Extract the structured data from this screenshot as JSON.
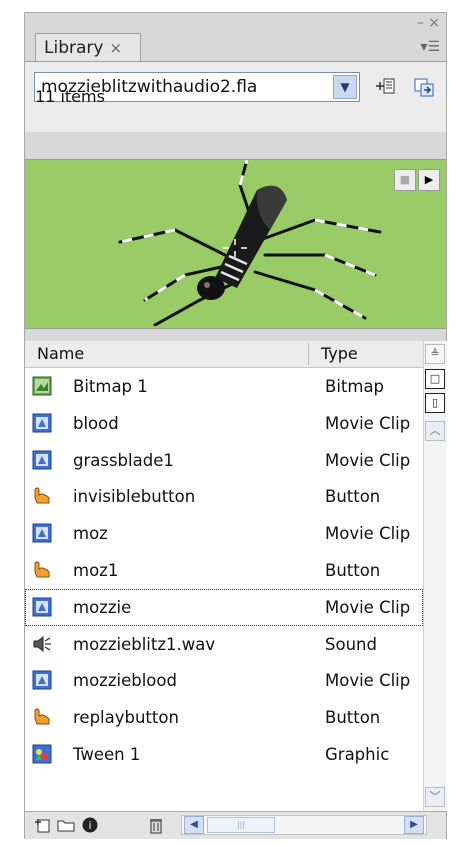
{
  "panel": {
    "tab_label": "Library",
    "tab_close": "×",
    "window_controls": "– ×",
    "panel_menu": "▾☰"
  },
  "topbar": {
    "document_select": "mozzieblitzwithaudio2.fla",
    "item_count": "11 items"
  },
  "preview": {
    "background_color": "#99cc66"
  },
  "columns": {
    "name": "Name",
    "type": "Type"
  },
  "items": [
    {
      "name": "Bitmap 1",
      "type": "Bitmap",
      "icon": "bitmap-icon"
    },
    {
      "name": "blood",
      "type": "Movie Clip",
      "icon": "movie-clip-icon"
    },
    {
      "name": "grassblade1",
      "type": "Movie Clip",
      "icon": "movie-clip-icon"
    },
    {
      "name": "invisiblebutton",
      "type": "Button",
      "icon": "button-symbol-icon"
    },
    {
      "name": "moz",
      "type": "Movie Clip",
      "icon": "movie-clip-icon"
    },
    {
      "name": "moz1",
      "type": "Button",
      "icon": "button-symbol-icon"
    },
    {
      "name": "mozzie",
      "type": "Movie Clip",
      "icon": "movie-clip-icon"
    },
    {
      "name": "mozzieblitz1.wav",
      "type": "Sound",
      "icon": "sound-icon"
    },
    {
      "name": "mozzieblood",
      "type": "Movie Clip",
      "icon": "movie-clip-icon"
    },
    {
      "name": "replaybutton",
      "type": "Button",
      "icon": "button-symbol-icon"
    },
    {
      "name": "Tween 1",
      "type": "Graphic",
      "icon": "graphic-icon"
    }
  ],
  "selected_item": "mozzie"
}
